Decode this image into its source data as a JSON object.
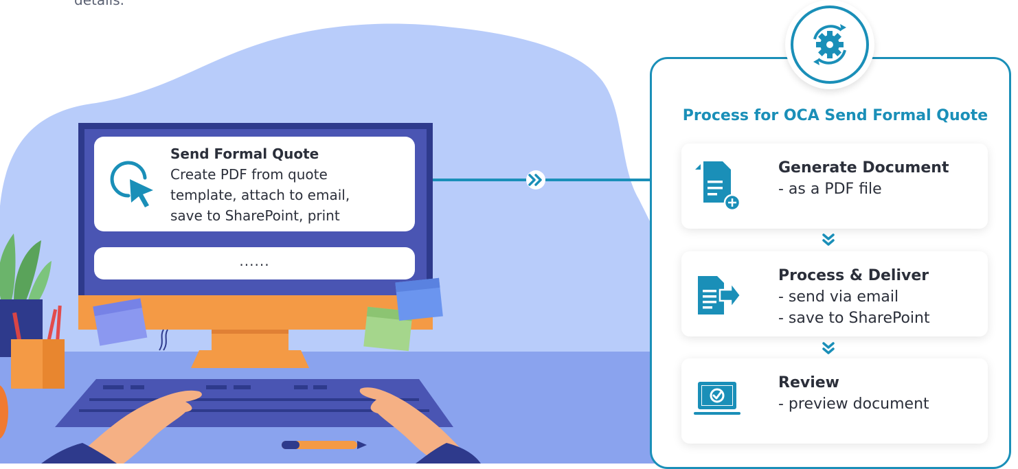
{
  "top_text": "details.",
  "monitor": {
    "card_title": "Send Formal Quote",
    "card_lines": [
      "Create PDF from quote",
      "template, attach to email,",
      "save to SharePoint, print"
    ],
    "card_icon": "cursor-click-icon",
    "second_card_text": "......"
  },
  "connector_icon": "double-chevron-right-icon",
  "panel": {
    "badge_icon": "gear-sync-icon",
    "title": "Process for OCA Send Formal Quote",
    "steps": [
      {
        "icon": "document-add-icon",
        "title": "Generate Document",
        "lines": [
          "- as a PDF file"
        ]
      },
      {
        "icon": "document-export-icon",
        "title": "Process & Deliver",
        "lines": [
          "- send via email",
          "- save to SharePoint"
        ]
      },
      {
        "icon": "laptop-check-icon",
        "title": "Review",
        "lines": [
          "- preview document"
        ]
      }
    ]
  },
  "colors": {
    "accent": "#1a8fb8",
    "blob": "#b8ccfa",
    "desk": "#8aa3ee",
    "monitor_frame": "#2e3a8c",
    "monitor_screen": "#4a55b3",
    "monitor_base": "#f49a45"
  }
}
